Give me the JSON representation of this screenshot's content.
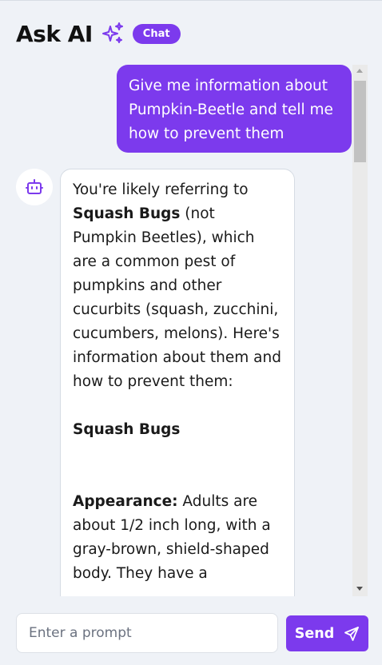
{
  "header": {
    "title": "Ask AI",
    "title_icon": "sparkles-icon",
    "badge": "Chat"
  },
  "messages": [
    {
      "role": "user",
      "text": "Give me information about Pumpkin-Beetle and tell me how to prevent them"
    },
    {
      "role": "assistant",
      "avatar_icon": "robot-icon",
      "intro_pre": "You're likely referring to ",
      "intro_bold": "Squash Bugs",
      "intro_post": " (not Pumpkin Beetles), which are a common pest of pumpkins and other cucurbits (squash, zucchini, cucumbers, melons). Here's information about them and how to prevent them:",
      "heading": "Squash Bugs",
      "appearance_label": "Appearance:",
      "appearance_text": " Adults are about 1/2 inch long, with a gray-brown, shield-shaped body. They have a"
    }
  ],
  "composer": {
    "placeholder": "Enter a prompt",
    "send_label": "Send",
    "send_icon": "send-icon"
  },
  "colors": {
    "accent": "#7c3aed",
    "background": "#eff2f7",
    "bubble_bot": "#ffffff"
  }
}
